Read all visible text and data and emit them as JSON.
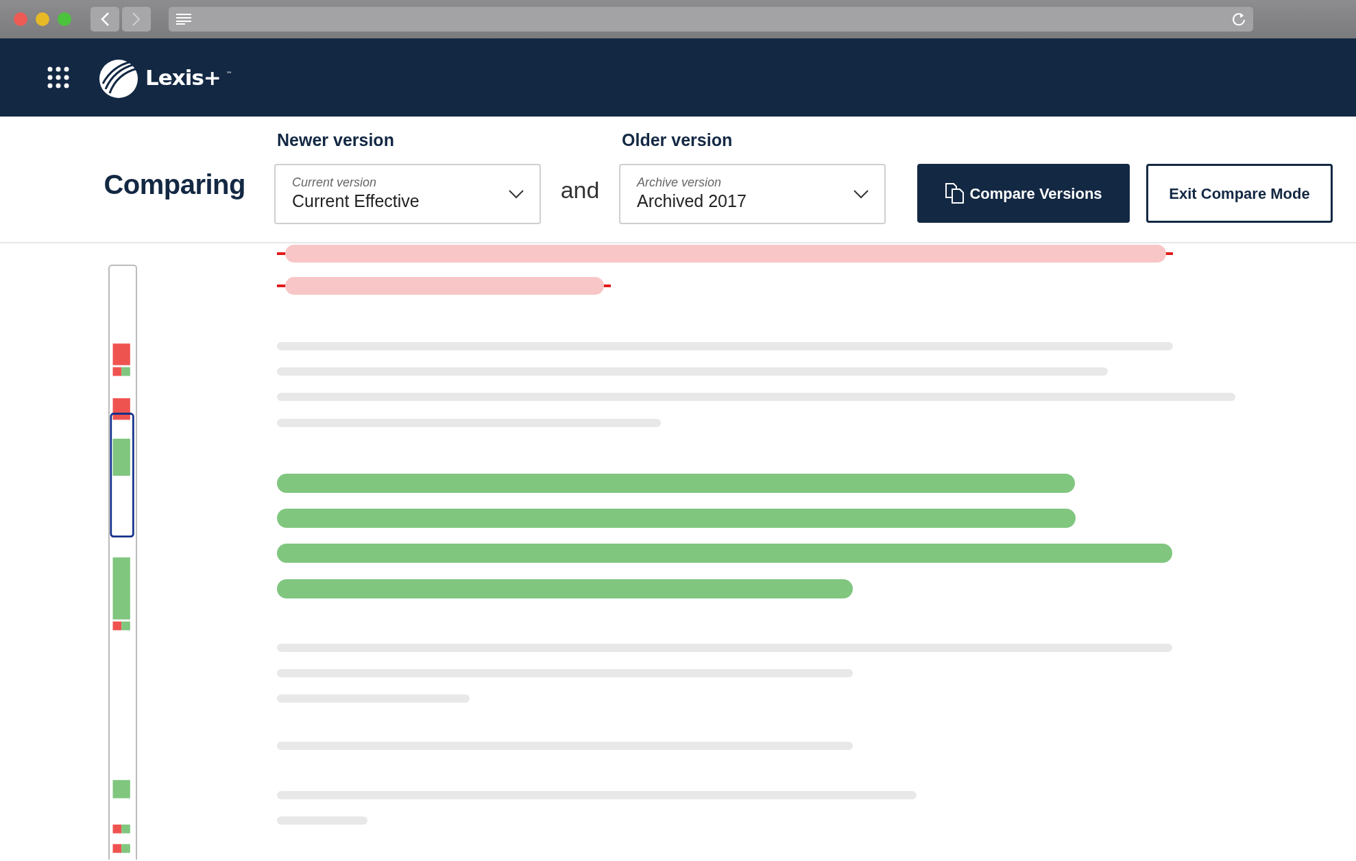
{
  "app": {
    "brand": "Lexis+",
    "trademark": "™"
  },
  "compare": {
    "title": "Comparing",
    "joiner": "and",
    "newer": {
      "heading": "Newer version",
      "placeholder": "Current version",
      "value": "Current Effective"
    },
    "older": {
      "heading": "Older version",
      "placeholder": "Archive version",
      "value": "Archived 2017"
    },
    "buttons": [
      {
        "label": "Compare Versions",
        "kind": "primary"
      },
      {
        "label": "Exit Compare Mode",
        "kind": "outline"
      }
    ]
  },
  "document_lines": [
    {
      "kind": "deleted"
    },
    {
      "kind": "deleted"
    },
    {
      "kind": "plain"
    },
    {
      "kind": "plain"
    },
    {
      "kind": "plain"
    },
    {
      "kind": "plain"
    },
    {
      "kind": "added"
    },
    {
      "kind": "added"
    },
    {
      "kind": "added"
    },
    {
      "kind": "added"
    },
    {
      "kind": "plain"
    },
    {
      "kind": "plain"
    },
    {
      "kind": "plain"
    },
    {
      "kind": "plain"
    },
    {
      "kind": "plain"
    },
    {
      "kind": "plain"
    }
  ]
}
